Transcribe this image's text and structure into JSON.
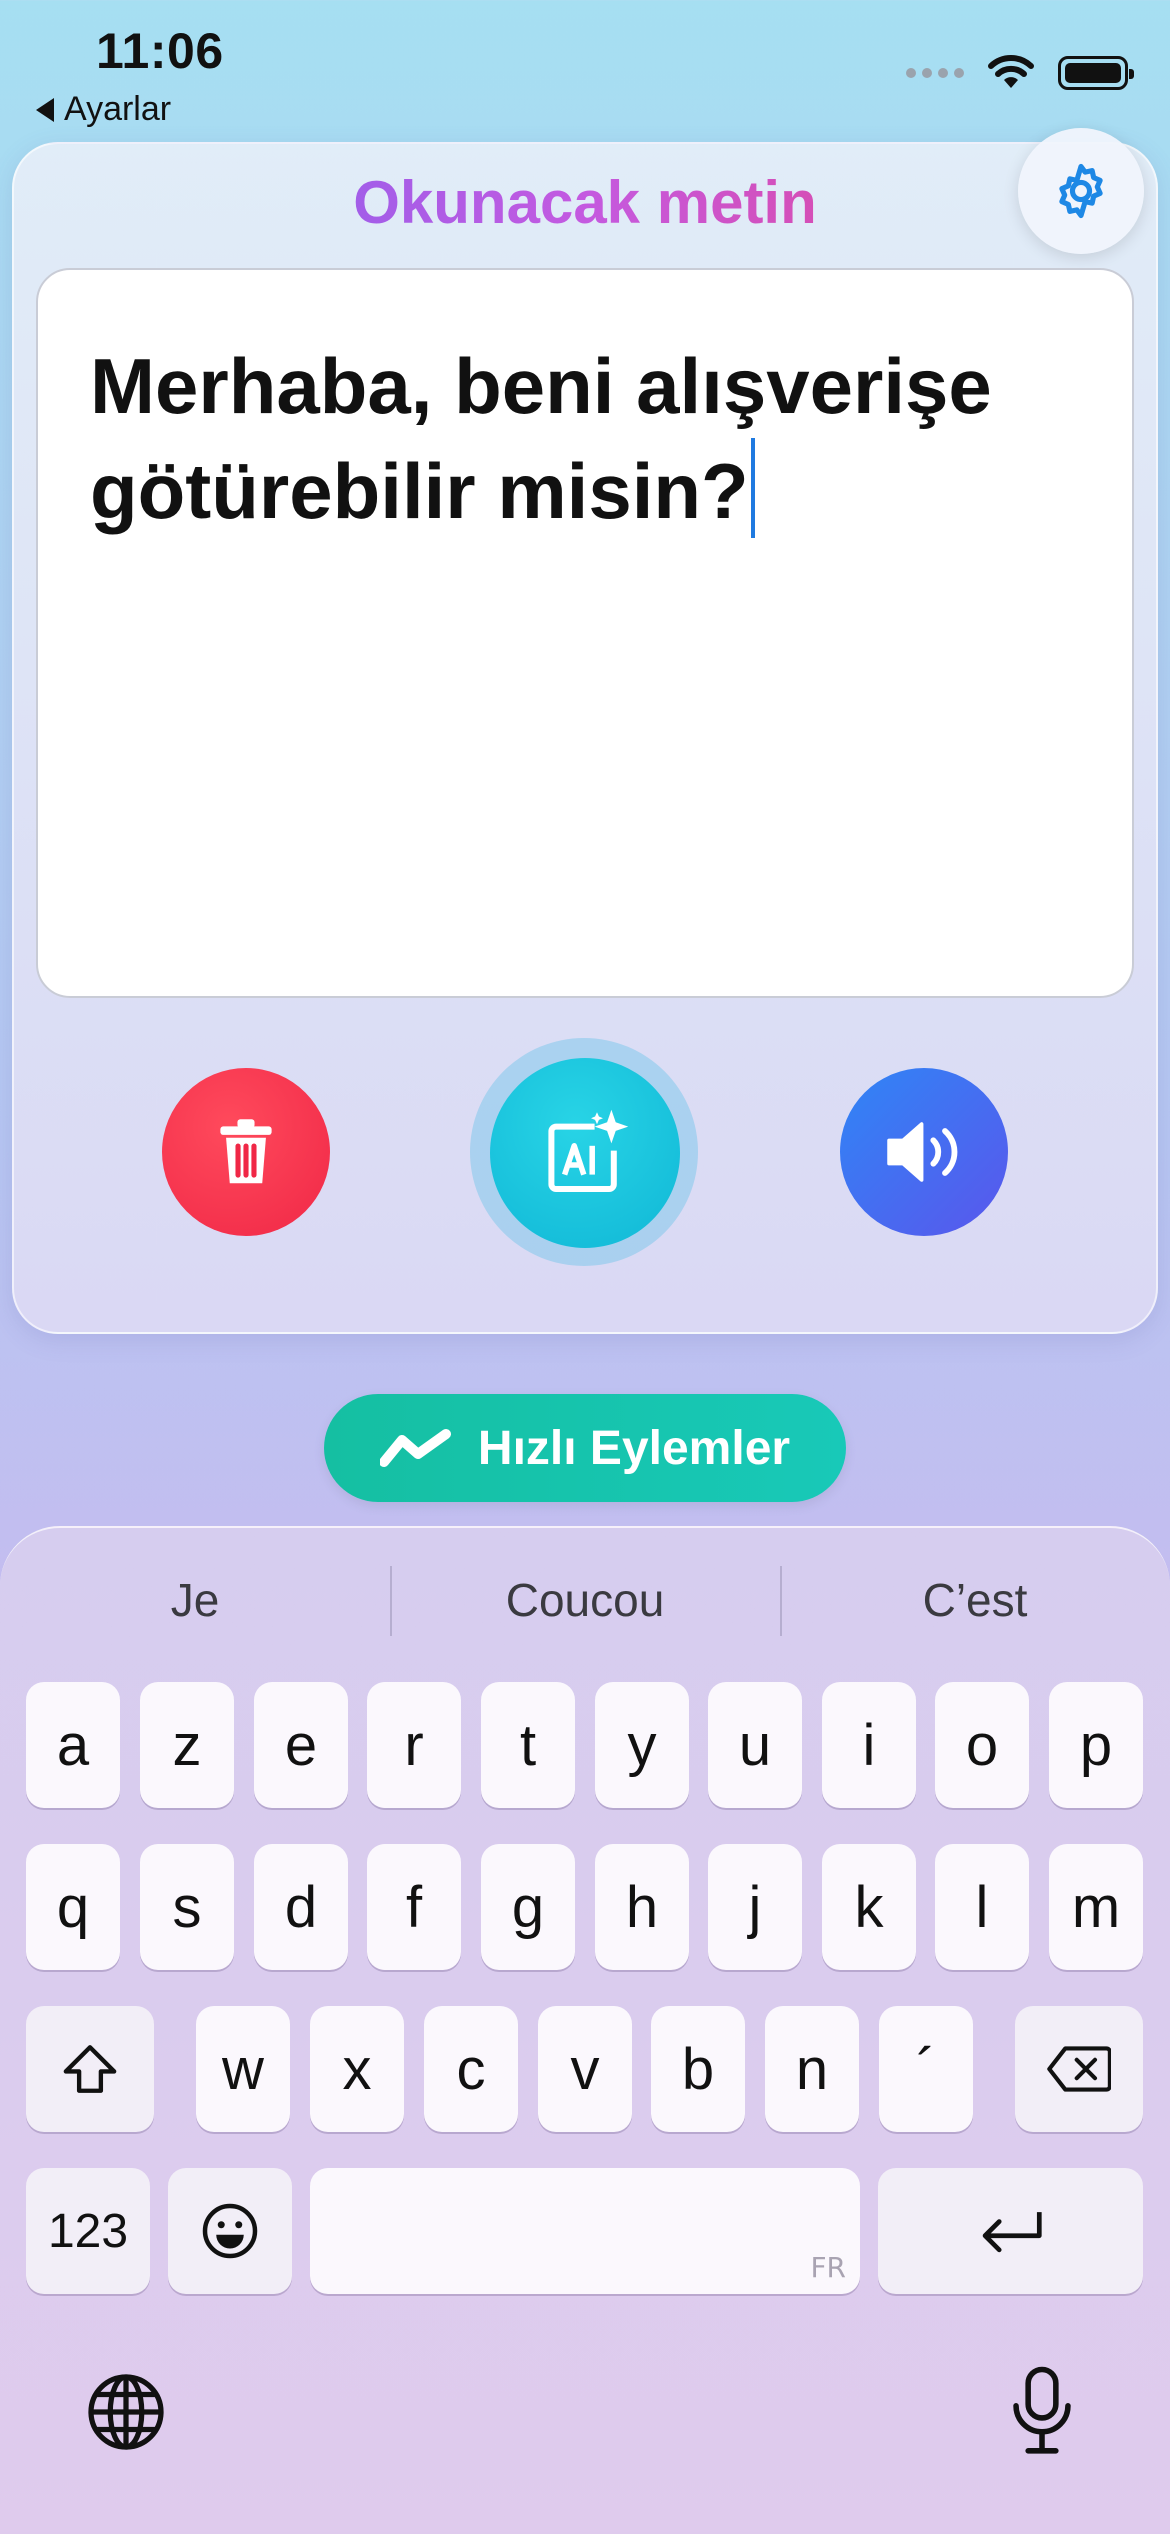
{
  "status": {
    "time": "11:06",
    "back_label": "Ayarlar"
  },
  "card": {
    "title": "Okunacak metin"
  },
  "editor": {
    "text": "Merhaba, beni alışverişe götürebilir misin?"
  },
  "quick_actions": {
    "label": "Hızlı Eylemler"
  },
  "keyboard": {
    "suggestions": [
      "Je",
      "Coucou",
      "C’est"
    ],
    "row1": [
      "a",
      "z",
      "e",
      "r",
      "t",
      "y",
      "u",
      "i",
      "o",
      "p"
    ],
    "row2": [
      "q",
      "s",
      "d",
      "f",
      "g",
      "h",
      "j",
      "k",
      "l",
      "m"
    ],
    "row3": [
      "w",
      "x",
      "c",
      "v",
      "b",
      "n",
      "´"
    ],
    "numbers_label": "123",
    "space_lang": "FR"
  },
  "colors": {
    "trash": "#f02746",
    "ai": "#10b7d6",
    "speaker": "#3f6ff2",
    "quick_actions": "#15bfa2",
    "caret": "#1f7ae0"
  },
  "icons": [
    "back-triangle-icon",
    "wifi-icon",
    "battery-icon",
    "gear-icon",
    "trash-icon",
    "ai-sparkle-icon",
    "speaker-icon",
    "chart-line-icon",
    "shift-icon",
    "backspace-icon",
    "emoji-icon",
    "return-icon",
    "globe-icon",
    "microphone-icon"
  ]
}
